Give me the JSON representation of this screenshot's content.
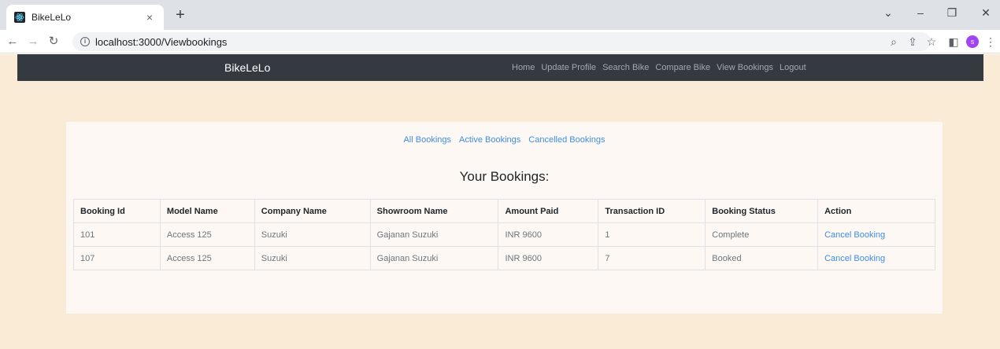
{
  "browser": {
    "tab_title": "BikeLeLo",
    "tab_close": "×",
    "new_tab": "+",
    "url": "localhost:3000/Viewbookings",
    "profile_initial": "s"
  },
  "navbar": {
    "brand": "BikeLeLo",
    "links": [
      "Home",
      "Update Profile",
      "Search Bike",
      "Compare Bike",
      "View Bookings",
      "Logout"
    ]
  },
  "filters": [
    "All Bookings",
    "Active Bookings",
    "Cancelled Bookings"
  ],
  "heading": "Your Bookings:",
  "table": {
    "headers": [
      "Booking Id",
      "Model Name",
      "Company Name",
      "Showroom Name",
      "Amount Paid",
      "Transaction ID",
      "Booking Status",
      "Action"
    ],
    "rows": [
      [
        "101",
        "Access 125",
        "Suzuki",
        "Gajanan Suzuki",
        "INR 9600",
        "1",
        "Complete",
        "Cancel Booking"
      ],
      [
        "107",
        "Access 125",
        "Suzuki",
        "Gajanan Suzuki",
        "INR 9600",
        "7",
        "Booked",
        "Cancel Booking"
      ]
    ]
  },
  "colors": {
    "page_bg": "#faebd7",
    "navbar_bg": "#343a40",
    "link": "#3f8de0"
  }
}
